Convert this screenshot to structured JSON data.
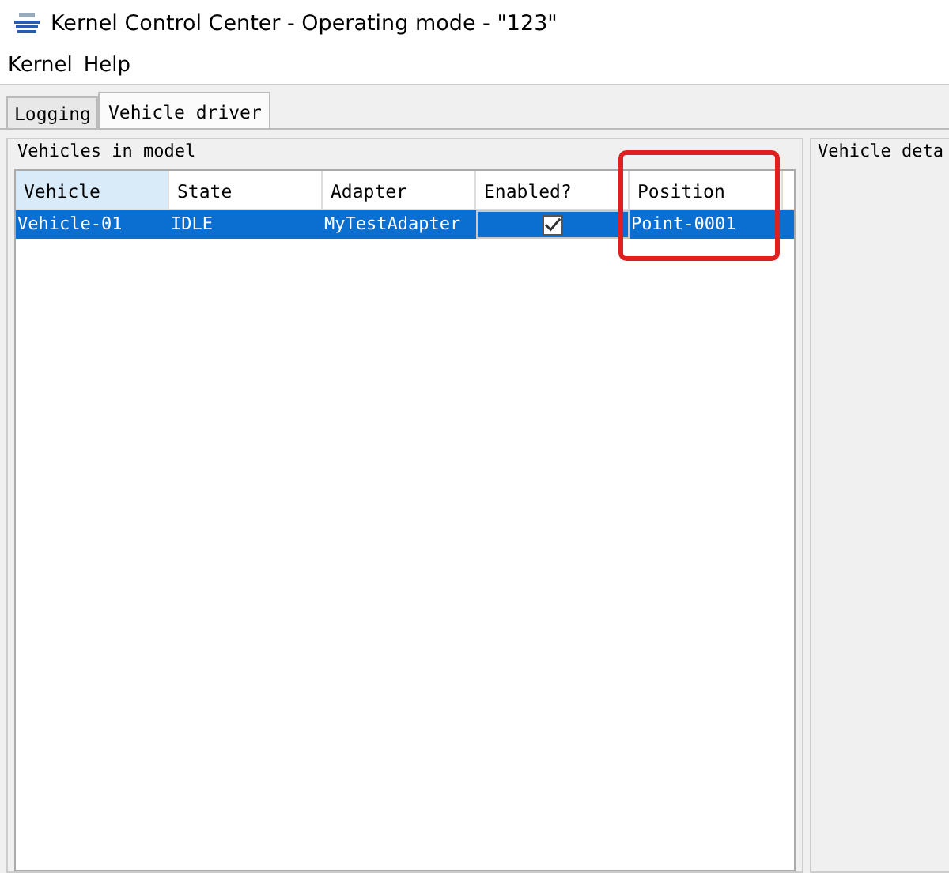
{
  "window": {
    "title": "Kernel Control Center - Operating mode - \"123\""
  },
  "menu": [
    "Kernel",
    "Help"
  ],
  "tabs": [
    {
      "label": "Logging",
      "selected": false
    },
    {
      "label": "Vehicle driver",
      "selected": true
    }
  ],
  "vehicles_panel": {
    "title": "Vehicles in model",
    "columns": [
      {
        "label": "Vehicle",
        "sorted": true,
        "highlighted": false
      },
      {
        "label": "State",
        "sorted": false,
        "highlighted": false
      },
      {
        "label": "Adapter",
        "sorted": false,
        "highlighted": false
      },
      {
        "label": "Enabled?",
        "sorted": false,
        "highlighted": false
      },
      {
        "label": "Position",
        "sorted": false,
        "highlighted": true
      }
    ],
    "rows": [
      {
        "selected": true,
        "vehicle": "Vehicle-01",
        "state": "IDLE",
        "adapter": "MyTestAdapter",
        "enabled": true,
        "position": "Point-0001"
      }
    ]
  },
  "details_panel": {
    "title": "Vehicle deta"
  }
}
